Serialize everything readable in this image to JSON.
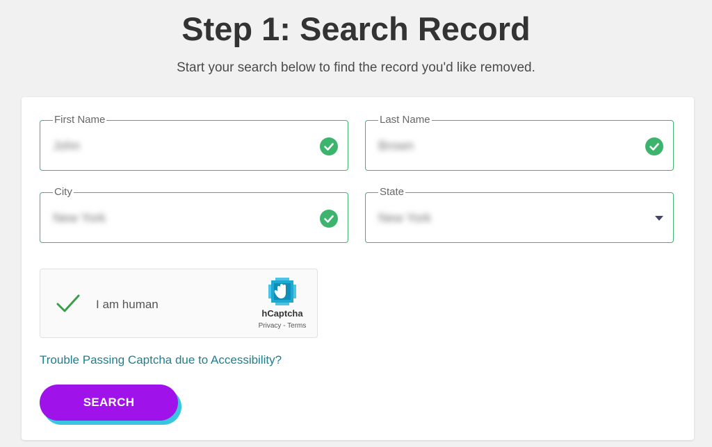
{
  "header": {
    "title": "Step 1: Search Record",
    "subtitle": "Start your search below to find the record you'd like removed."
  },
  "form": {
    "first_name": {
      "label": "First Name",
      "value": "John",
      "valid": true
    },
    "last_name": {
      "label": "Last Name",
      "value": "Brown",
      "valid": true
    },
    "city": {
      "label": "City",
      "value": "New York",
      "valid": true
    },
    "state": {
      "label": "State",
      "value": "New York",
      "type": "select"
    }
  },
  "captcha": {
    "label": "I am human",
    "brand": "hCaptcha",
    "privacy_link": "Privacy",
    "separator": " - ",
    "terms_link": "Terms",
    "checked": true
  },
  "accessibility_link": "Trouble Passing Captcha due to Accessibility?",
  "search_button": "SEARCH",
  "colors": {
    "background": "#f1f1f1",
    "field_border": "#3cb46e",
    "valid_check": "#3cb46e",
    "link": "#1e7f8c",
    "button": "#a012ea",
    "button_shadow": "#39c4e0",
    "captcha_check": "#3a9d4a"
  },
  "icons": {
    "valid": "check-circle-icon",
    "dropdown": "caret-down-icon",
    "captcha_check": "checkmark-icon",
    "captcha_logo": "hcaptcha-logo-icon"
  }
}
